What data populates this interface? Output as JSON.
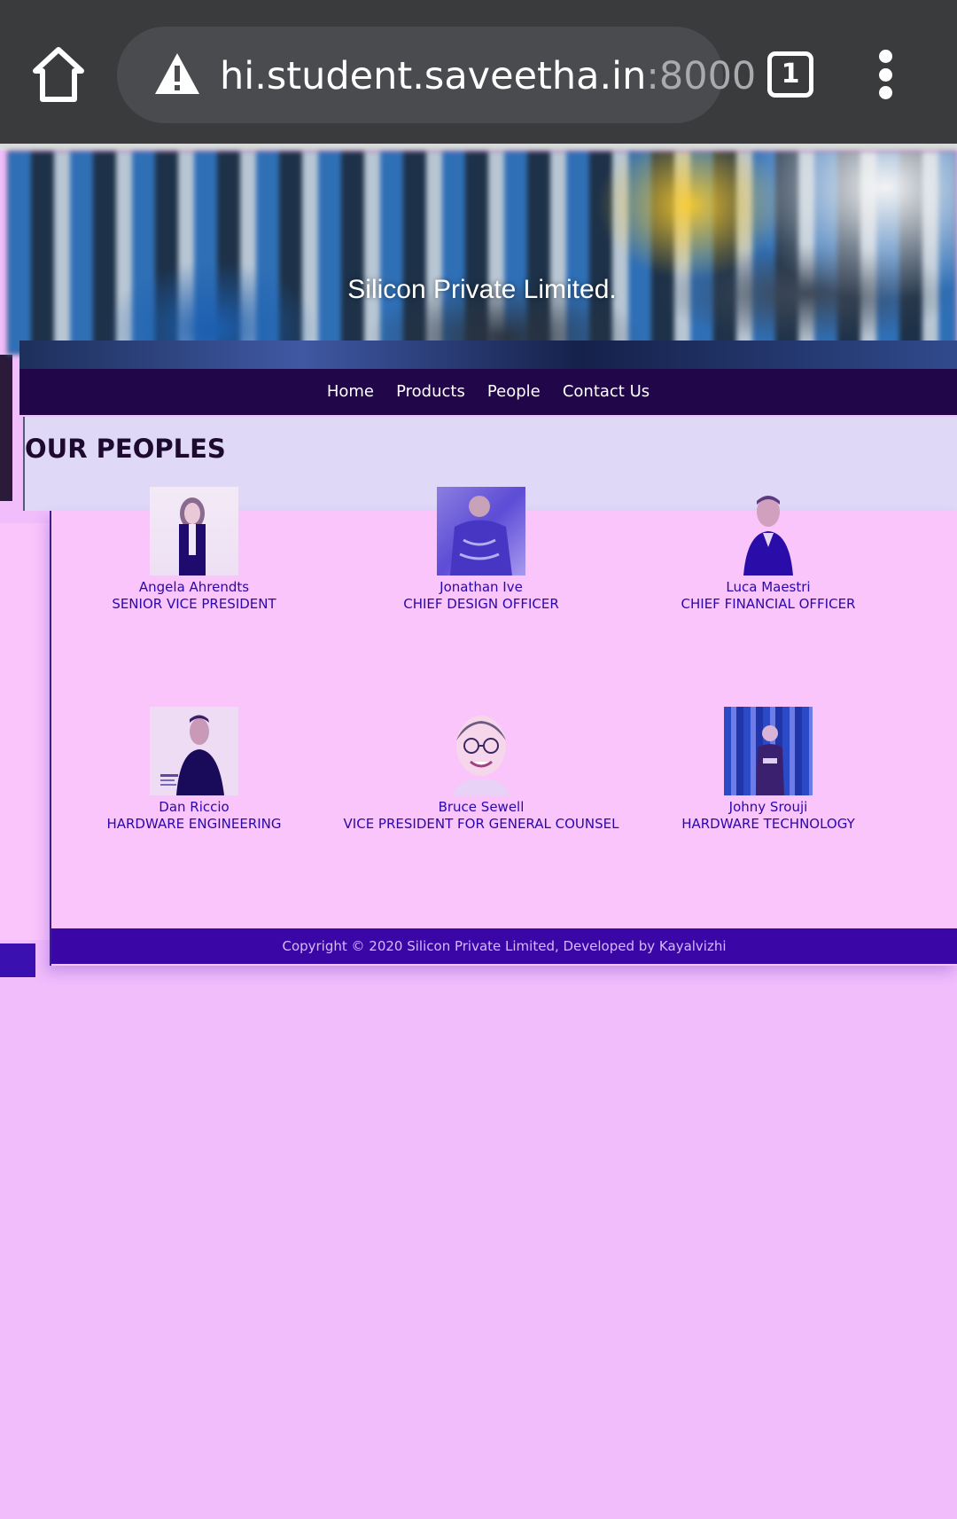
{
  "browser": {
    "url_host": "hi.student.saveetha.in",
    "url_port": ":8000",
    "tab_count": "1",
    "icons": [
      "home-icon",
      "warning-icon",
      "tabs-icon",
      "more-vert-icon"
    ]
  },
  "site": {
    "title": "Silicon Private Limited.",
    "nav": [
      "Home",
      "Products",
      "People",
      "Contact Us"
    ]
  },
  "people_section": {
    "heading": "OUR PEOPLES",
    "people": [
      {
        "name": "Angela Ahrendts",
        "role": "SENIOR VICE PRESIDENT"
      },
      {
        "name": "Jonathan Ive",
        "role": "CHIEF DESIGN OFFICER"
      },
      {
        "name": "Luca Maestri",
        "role": "CHIEF FINANCIAL OFFICER"
      },
      {
        "name": "Dan Riccio",
        "role": "HARDWARE ENGINEERING"
      },
      {
        "name": "Bruce Sewell",
        "role": "VICE PRESIDENT FOR GENERAL COUNSEL"
      },
      {
        "name": "Johny Srouji",
        "role": "HARDWARE TECHNOLOGY"
      }
    ]
  },
  "footer": {
    "copyright": "Copyright © 2020 Silicon Private Limited, Developed by Kayalvizhi"
  },
  "colors": {
    "browser_chrome": "#3a3b3d",
    "nav_bg": "#22064a",
    "panel_bg": "#fac5fb",
    "footer_bg": "#3a06a6",
    "text_accent": "#2a07a8"
  }
}
